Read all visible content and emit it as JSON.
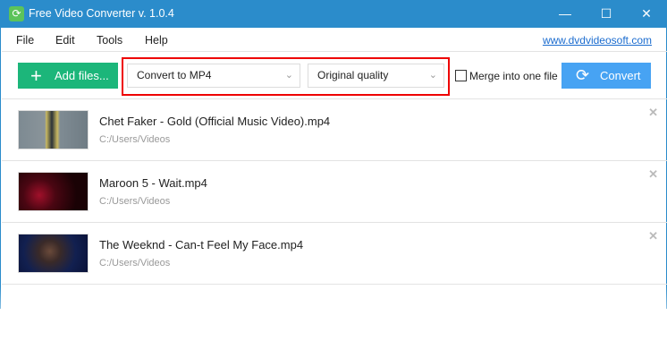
{
  "window": {
    "title": "Free Video Converter v. 1.0.4",
    "minimize": "—",
    "maximize": "☐",
    "close": "✕"
  },
  "menu": {
    "items": [
      "File",
      "Edit",
      "Tools",
      "Help"
    ],
    "site_link": "www.dvdvideosoft.com"
  },
  "toolbar": {
    "add_files": "Add files...",
    "format": "Convert to MP4",
    "quality": "Original quality",
    "merge_label": "Merge into one file",
    "merge_checked": false,
    "convert": "Convert"
  },
  "files": [
    {
      "name": "Chet Faker - Gold (Official Music Video).mp4",
      "path": "C:/Users/Videos"
    },
    {
      "name": "Maroon 5 - Wait.mp4",
      "path": "C:/Users/Videos"
    },
    {
      "name": "The Weeknd - Can-t Feel My Face.mp4",
      "path": "C:/Users/Videos"
    }
  ],
  "colors": {
    "titlebar": "#2b8ccb",
    "add": "#1cb67a",
    "convert": "#47a3f3",
    "highlight": "#e00000"
  }
}
